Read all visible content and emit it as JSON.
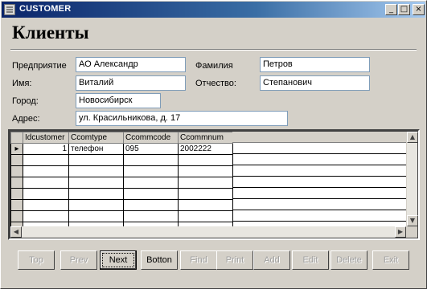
{
  "window": {
    "title": "CUSTOMER",
    "minimize": "_",
    "maximize": "□",
    "close": "×"
  },
  "form": {
    "heading": "Клиенты",
    "labels": {
      "company": "Предприятие",
      "first_name": "Имя:",
      "city": "Город:",
      "address": "Адрес:",
      "last_name": "Фамилия",
      "patronymic": "Отчество:"
    },
    "values": {
      "company": "АО Александр",
      "first_name": "Виталий",
      "city": "Новосибирск",
      "address": "ул. Красильникова, д. 17",
      "last_name": "Петров",
      "patronymic": "Степанович"
    }
  },
  "grid": {
    "columns": [
      "Idcustomer",
      "Ccomtype",
      "Ccommcode",
      "Ccommnum"
    ],
    "rows": [
      {
        "indicator": "▸",
        "cells": [
          "1",
          "телефон",
          "095",
          "2002222"
        ]
      }
    ]
  },
  "scroll_icons": {
    "up": "▲",
    "down": "▼",
    "left": "◀",
    "right": "▶"
  },
  "nav": {
    "top": "Top",
    "prev": "Prev",
    "next": "Next",
    "bottom": "Botton",
    "find": "Find",
    "print": "Print",
    "add": "Add",
    "edit": "Edit",
    "delete": "Delete",
    "exit": "Exit"
  }
}
